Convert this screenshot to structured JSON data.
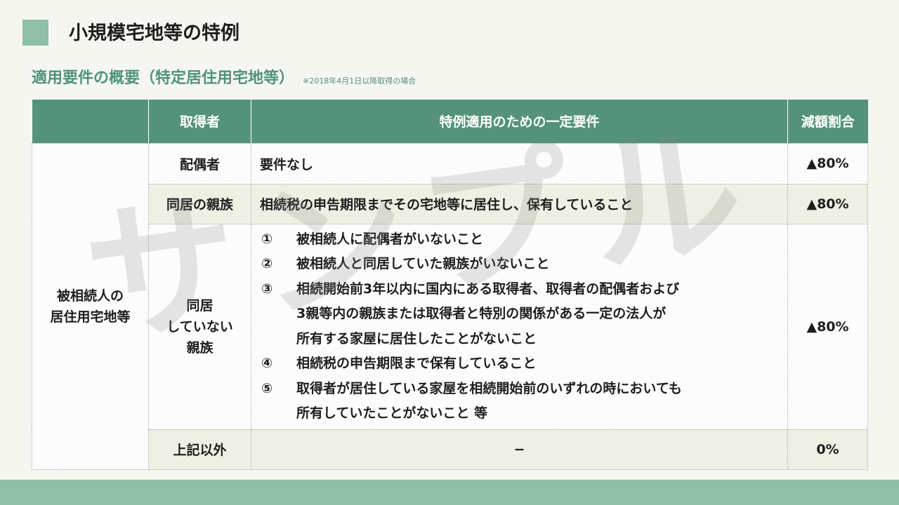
{
  "page_title": "小規模宅地等の特例",
  "subtitle": "適用要件の概要（特定居住用宅地等）",
  "subtitle_note": "※2018年4月1日以降取得の場合",
  "table": {
    "headers": [
      "",
      "取得者",
      "特例適用のための一定要件",
      "減額割合"
    ],
    "category": [
      "被相続人の",
      "居住用宅地等"
    ],
    "rows": [
      {
        "acquirer": [
          "配偶者"
        ],
        "requirement": "要件なし",
        "reduction": "▲80%"
      },
      {
        "acquirer": [
          "同居の親族"
        ],
        "requirement": "相続税の申告期限までその宅地等に居住し、保有していること",
        "reduction": "▲80%"
      },
      {
        "acquirer": [
          "同居",
          "していない",
          "親族"
        ],
        "conditions": [
          {
            "num": "①",
            "lines": [
              "被相続人に配偶者がいないこと"
            ]
          },
          {
            "num": "②",
            "lines": [
              "被相続人と同居していた親族がいないこと"
            ]
          },
          {
            "num": "③",
            "lines": [
              "相続開始前3年以内に国内にある取得者、取得者の配偶者および",
              "3親等内の親族または取得者と特別の関係がある一定の法人が",
              "所有する家屋に居住したことがないこと"
            ]
          },
          {
            "num": "④",
            "lines": [
              "相続税の申告期限まで保有していること"
            ]
          },
          {
            "num": "⑤",
            "lines": [
              "取得者が居住している家屋を相続開始前のいずれの時においても",
              "所有していたことがないこと 等"
            ]
          }
        ],
        "reduction": "▲80%"
      },
      {
        "acquirer": [
          "上記以外"
        ],
        "requirement": "−",
        "reduction": "0%"
      }
    ]
  },
  "watermark": "サンプル",
  "colors": {
    "accent": "#54937a",
    "accent_light": "#8fbfa8",
    "subtitle": "#4e9478",
    "beige_row": "#eef0e3",
    "background": "#f6f6f1"
  }
}
